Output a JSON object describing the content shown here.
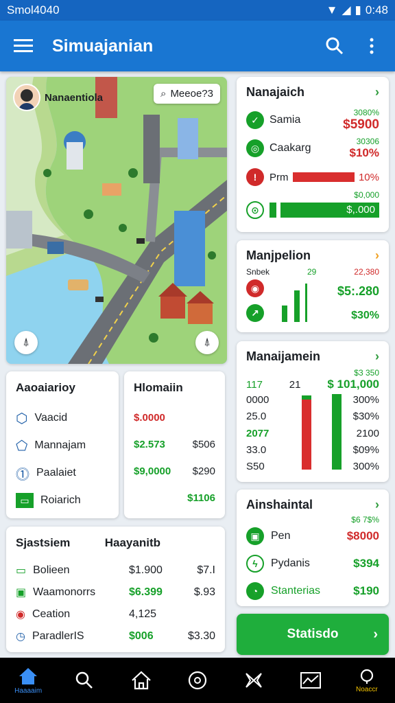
{
  "status": {
    "time_left": "Smol4040",
    "time_right": "0:48"
  },
  "appbar": {
    "title": "Simuajanian"
  },
  "map": {
    "profile_name": "Nanaentiola",
    "search_text": "Meeoe?3"
  },
  "panel1": {
    "title": "Nanajaich",
    "rows": [
      {
        "label": "Samia",
        "small": "3080%",
        "value": "$5900"
      },
      {
        "label": "Caakarg",
        "small": "30306",
        "value": "$10%"
      },
      {
        "label": "Prm",
        "value": "10%"
      },
      {
        "small": "$0,000",
        "value": "$,.000"
      }
    ]
  },
  "panel2": {
    "title": "Manjpelion",
    "sub_left": "Snbek",
    "sub_mid": "29",
    "small": "22,380",
    "value1": "$5:.280",
    "value2": "$30%"
  },
  "panel3": {
    "title": "Manaijamein",
    "small": "$3 350",
    "head_left": "117",
    "head_mid": "21",
    "head_value": "$ 101,000",
    "left_values": [
      "0000",
      "25.0",
      "2077",
      "33.0",
      "S50"
    ],
    "right_values": [
      "300%",
      "$30%",
      "2100",
      "$09%",
      "300%"
    ]
  },
  "panel4": {
    "title": "Ainshaintal",
    "small": "$6 7$%",
    "rows": [
      {
        "label": "Pen",
        "value": "$8000"
      },
      {
        "label": "Pydanis",
        "value": "$394"
      },
      {
        "label": "Stanterias",
        "value": "$190"
      }
    ]
  },
  "list1": {
    "title": "Aaoaiarioy",
    "items": [
      "Vaacid",
      "Mannajam",
      "Paalaiet",
      "Roiarich"
    ]
  },
  "values1": {
    "title": "Hlomaiin",
    "rows": [
      {
        "a": "$.0000",
        "b": ""
      },
      {
        "a": "$2.573",
        "b": "$506"
      },
      {
        "a": "$9,0000",
        "b": "$290"
      },
      {
        "a": "",
        "b": "$1106"
      }
    ]
  },
  "list2": {
    "title": "Sjastsiem",
    "items": [
      "Bolieen",
      "Waamonorrs",
      "Ceation",
      "ParadlerIS"
    ]
  },
  "values2": {
    "title": "Haayanitb",
    "rows": [
      {
        "a": "$1.900",
        "b": "$7.I"
      },
      {
        "a": "$6.399",
        "b": "$.93"
      },
      {
        "a": "4,125",
        "b": ""
      },
      {
        "a": "$006",
        "b": "$3.30"
      }
    ]
  },
  "cta": {
    "label": "Statisdo",
    "arrow": "›"
  },
  "nav": {
    "home_label": "Haaaaim",
    "last_label": "Noaccr"
  }
}
